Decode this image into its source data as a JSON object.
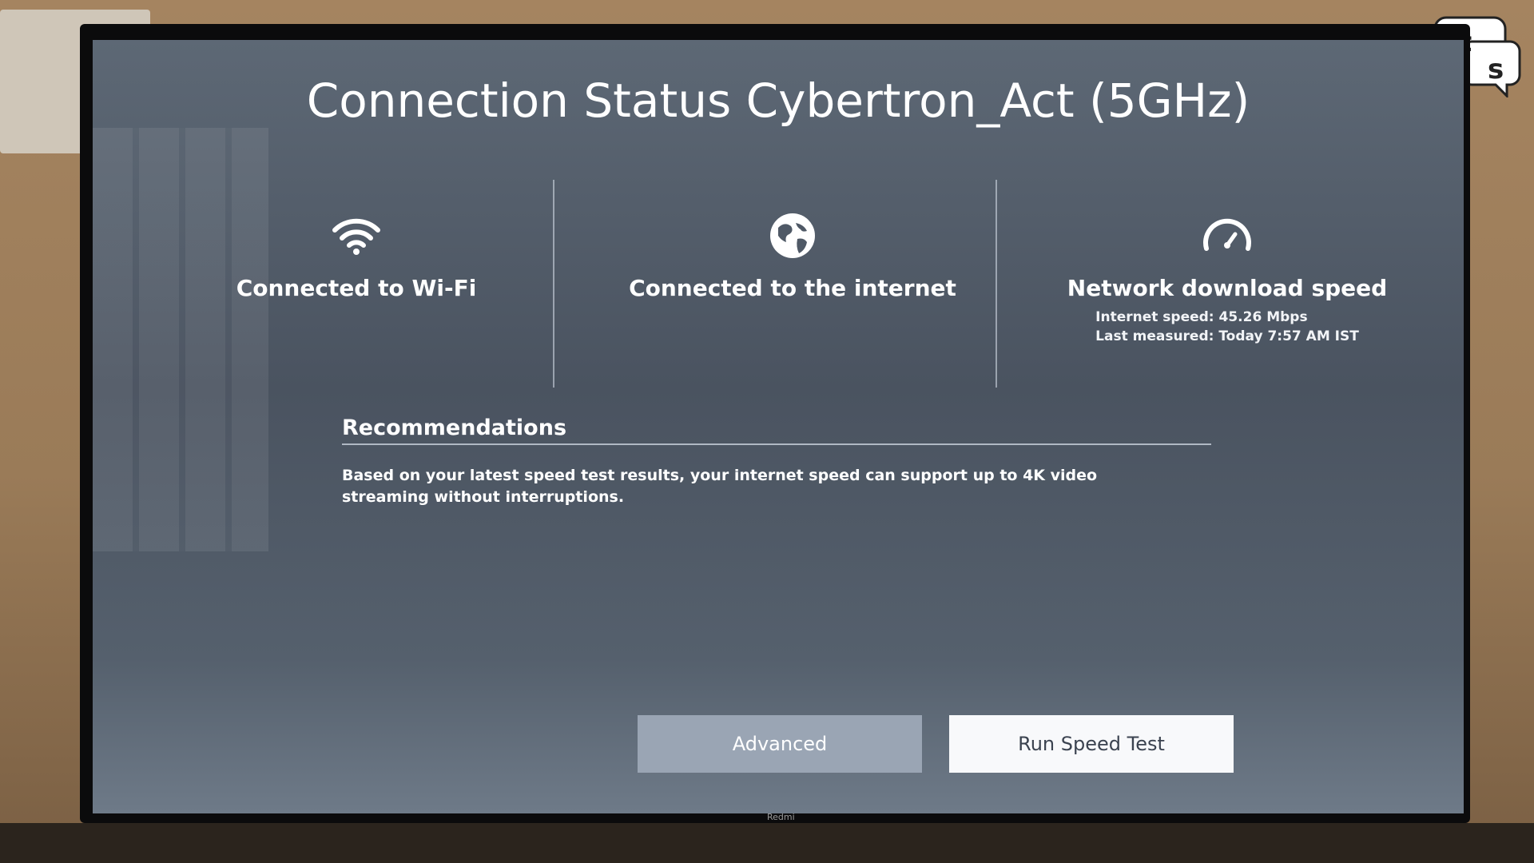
{
  "screen": {
    "title": "Connection Status Cybertron_Act (5GHz)"
  },
  "status_columns": [
    {
      "icon": "wifi-icon",
      "label": "Connected to Wi-Fi"
    },
    {
      "icon": "globe-icon",
      "label": "Connected to the internet"
    },
    {
      "icon": "speedometer-icon",
      "label": "Network download speed",
      "internet_speed": "Internet speed: 45.26 Mbps",
      "last_measured": "Last measured: Today 7:57 AM IST"
    }
  ],
  "recommendations": {
    "heading": "Recommendations",
    "text": "Based on your latest speed test results, your internet speed can support up to 4K video streaming without interruptions."
  },
  "buttons": {
    "advanced": "Advanced",
    "run_speed_test": "Run Speed Test"
  },
  "tv_brand": "Redmi",
  "colors": {
    "screen_bg": "#4a5360",
    "focused_button": "#f8f9fb",
    "unfocused_button": "#9aa5b4"
  }
}
